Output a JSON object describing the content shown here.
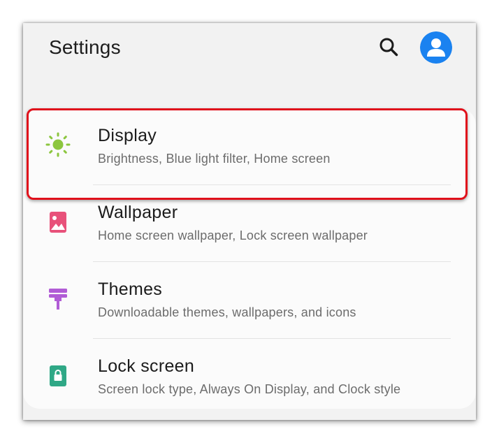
{
  "header": {
    "title": "Settings",
    "search_icon": "search-icon",
    "profile_icon": "account-avatar-icon"
  },
  "items": [
    {
      "title": "Display",
      "subtitle": "Brightness, Blue light filter, Home screen",
      "icon": "sun-icon",
      "icon_color": "#8cc63f"
    },
    {
      "title": "Wallpaper",
      "subtitle": "Home screen wallpaper, Lock screen wallpaper",
      "icon": "wallpaper-icon",
      "icon_color": "#e8517a"
    },
    {
      "title": "Themes",
      "subtitle": "Downloadable themes, wallpapers, and icons",
      "icon": "paintbrush-icon",
      "icon_color": "#b15cd6"
    },
    {
      "title": "Lock screen",
      "subtitle": "Screen lock type, Always On Display, and Clock style",
      "icon": "lock-icon",
      "icon_color": "#2fa886"
    }
  ],
  "colors": {
    "accent": "#1a82f0",
    "highlight_border": "#e0101b",
    "background": "#f2f2f2",
    "card": "#fbfbfb"
  }
}
